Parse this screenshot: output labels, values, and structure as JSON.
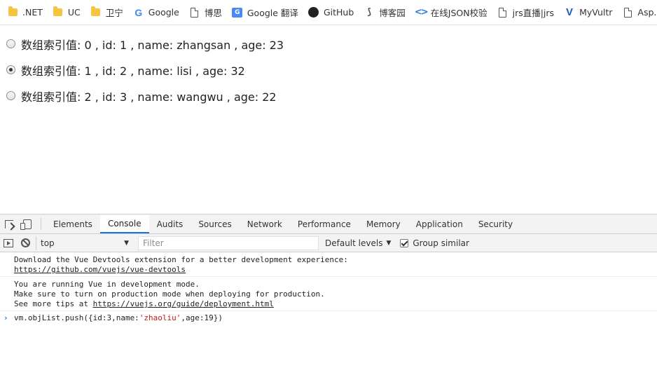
{
  "bookmarks": [
    {
      "label": ".NET",
      "icon": "folder-icon"
    },
    {
      "label": "UC",
      "icon": "folder-icon"
    },
    {
      "label": "卫宁",
      "icon": "folder-icon"
    },
    {
      "label": "Google",
      "icon": "google-icon"
    },
    {
      "label": "博思",
      "icon": "page-icon"
    },
    {
      "label": "Google 翻译",
      "icon": "google-translate-icon"
    },
    {
      "label": "GitHub",
      "icon": "github-icon"
    },
    {
      "label": "博客园",
      "icon": "cnblogs-icon"
    },
    {
      "label": "在线JSON校验",
      "icon": "code-icon"
    },
    {
      "label": "jrs直播|jrs",
      "icon": "page-icon"
    },
    {
      "label": "MyVultr",
      "icon": "vultr-icon"
    },
    {
      "label": "Asp.Net",
      "icon": "page-icon"
    }
  ],
  "list": [
    {
      "text": "数组索引值: 0 , id: 1 , name: zhangsan , age: 23",
      "checked": false
    },
    {
      "text": "数组索引值: 1 , id: 2 , name: lisi , age: 32",
      "checked": true
    },
    {
      "text": "数组索引值: 2 , id: 3 , name: wangwu , age: 22",
      "checked": false
    }
  ],
  "devtools": {
    "tabs": [
      "Elements",
      "Console",
      "Audits",
      "Sources",
      "Network",
      "Performance",
      "Memory",
      "Application",
      "Security"
    ],
    "active_tab": "Console",
    "context": "top",
    "filter_placeholder": "Filter",
    "levels": "Default levels",
    "group_similar": "Group similar",
    "group_similar_checked": true
  },
  "console": {
    "msg1_line1": "Download the Vue Devtools extension for a better development experience:",
    "msg1_link": "https://github.com/vuejs/vue-devtools",
    "msg2_line1": "You are running Vue in development mode.",
    "msg2_line2": "Make sure to turn on production mode when deploying for production.",
    "msg2_line3_prefix": "See more tips at ",
    "msg2_link": "https://vuejs.org/guide/deployment.html",
    "prompt_before": "vm.objList.push({id:3,name:",
    "prompt_string": "'zhaoliu'",
    "prompt_after": ",age:19})"
  }
}
